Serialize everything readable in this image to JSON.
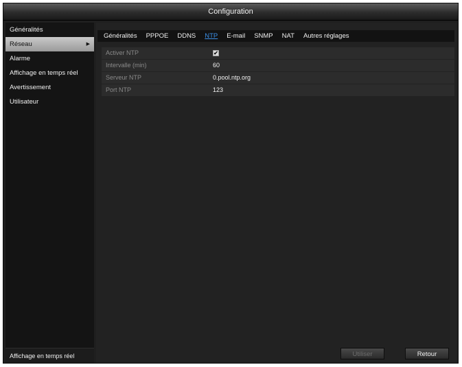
{
  "window": {
    "title": "Configuration"
  },
  "sidebar": {
    "items": [
      {
        "label": "Généralités",
        "active": false
      },
      {
        "label": "Réseau",
        "active": true
      },
      {
        "label": "Alarme",
        "active": false
      },
      {
        "label": "Affichage en temps réel",
        "active": false
      },
      {
        "label": "Avertissement",
        "active": false
      },
      {
        "label": "Utilisateur",
        "active": false
      }
    ],
    "active_arrow": "▶",
    "bottom_label": "Affichage en temps réel"
  },
  "tabs": [
    {
      "label": "Généralités",
      "active": false
    },
    {
      "label": "PPPOE",
      "active": false
    },
    {
      "label": "DDNS",
      "active": false
    },
    {
      "label": "NTP",
      "active": true
    },
    {
      "label": "E-mail",
      "active": false
    },
    {
      "label": "SNMP",
      "active": false
    },
    {
      "label": "NAT",
      "active": false
    },
    {
      "label": "Autres réglages",
      "active": false
    }
  ],
  "form": {
    "enable_ntp": {
      "label": "Activer NTP",
      "checked": true,
      "mark": "✔"
    },
    "interval": {
      "label": "Intervalle (min)",
      "value": "60"
    },
    "server": {
      "label": "Serveur NTP",
      "value": "0.pool.ntp.org"
    },
    "port": {
      "label": "Port NTP",
      "value": "123"
    }
  },
  "buttons": {
    "apply": "Utiliser",
    "back": "Retour"
  },
  "colors": {
    "accent_tab": "#3b8fe6",
    "background": "#222222",
    "sidebar": "#141414"
  }
}
